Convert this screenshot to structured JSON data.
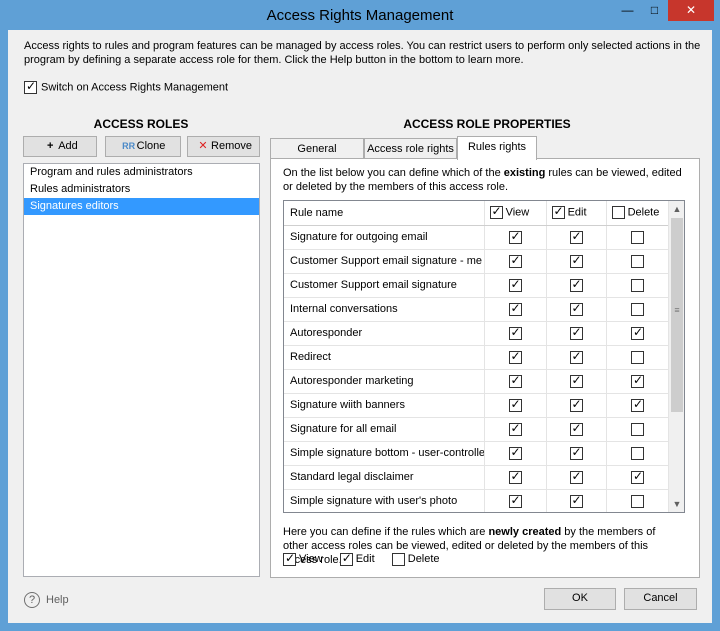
{
  "window": {
    "title": "Access Rights Management"
  },
  "intro": "Access rights to rules and program features can be managed by access roles. You can restrict users to perform only selected actions in the program by defining a separate access role for them. Click the Help button in the bottom to learn more.",
  "switch": {
    "label": "Switch on Access Rights Management",
    "checked": true
  },
  "roles": {
    "heading": "ACCESS ROLES",
    "add_label": "Add",
    "clone_label": "Clone",
    "remove_label": "Remove",
    "items": [
      {
        "label": "Program and rules administrators",
        "selected": false
      },
      {
        "label": "Rules administrators",
        "selected": false
      },
      {
        "label": "Signatures editors",
        "selected": true
      }
    ]
  },
  "props": {
    "heading": "ACCESS ROLE PROPERTIES",
    "tabs": [
      {
        "label": "General",
        "active": false
      },
      {
        "label": "Access role rights",
        "active": false
      },
      {
        "label": "Rules rights",
        "active": true
      }
    ],
    "desc_pre": "On the list below you can define which of the ",
    "desc_bold": "existing",
    "desc_post": " rules can be viewed, edited or deleted by the members of this access role.",
    "grid": {
      "col_name": "Rule name",
      "col_view": "View",
      "col_edit": "Edit",
      "col_delete": "Delete",
      "header_view": true,
      "header_edit": true,
      "header_delete": false,
      "rows": [
        {
          "name": "Signature for outgoing email",
          "view": true,
          "edit": true,
          "delete": false
        },
        {
          "name": "Customer Support email signature - me",
          "view": true,
          "edit": true,
          "delete": false
        },
        {
          "name": "Customer Support email signature",
          "view": true,
          "edit": true,
          "delete": false
        },
        {
          "name": "Internal conversations",
          "view": true,
          "edit": true,
          "delete": false
        },
        {
          "name": "Autoresponder",
          "view": true,
          "edit": true,
          "delete": true
        },
        {
          "name": "Redirect",
          "view": true,
          "edit": true,
          "delete": false
        },
        {
          "name": "Autoresponder marketing",
          "view": true,
          "edit": true,
          "delete": true
        },
        {
          "name": "Signature wiith banners",
          "view": true,
          "edit": true,
          "delete": true
        },
        {
          "name": "Signature for all email",
          "view": true,
          "edit": true,
          "delete": false
        },
        {
          "name": "Simple signature bottom - user-controlle",
          "view": true,
          "edit": true,
          "delete": false
        },
        {
          "name": "Standard legal disclaimer",
          "view": true,
          "edit": true,
          "delete": true
        },
        {
          "name": "Simple signature with user's photo",
          "view": true,
          "edit": true,
          "delete": false
        }
      ]
    },
    "new_pre": "Here you can define if the rules which are ",
    "new_bold": "newly created",
    "new_post": " by the members of other access roles can be viewed, edited or deleted by the members of this access role.",
    "new_view_label": "View",
    "new_edit_label": "Edit",
    "new_delete_label": "Delete",
    "new_view": true,
    "new_edit": true,
    "new_delete": false
  },
  "footer": {
    "help_label": "Help",
    "ok_label": "OK",
    "cancel_label": "Cancel"
  },
  "colors": {
    "titlebar": "#5fa0d6",
    "selection": "#3399ff",
    "close": "#c7362c"
  }
}
